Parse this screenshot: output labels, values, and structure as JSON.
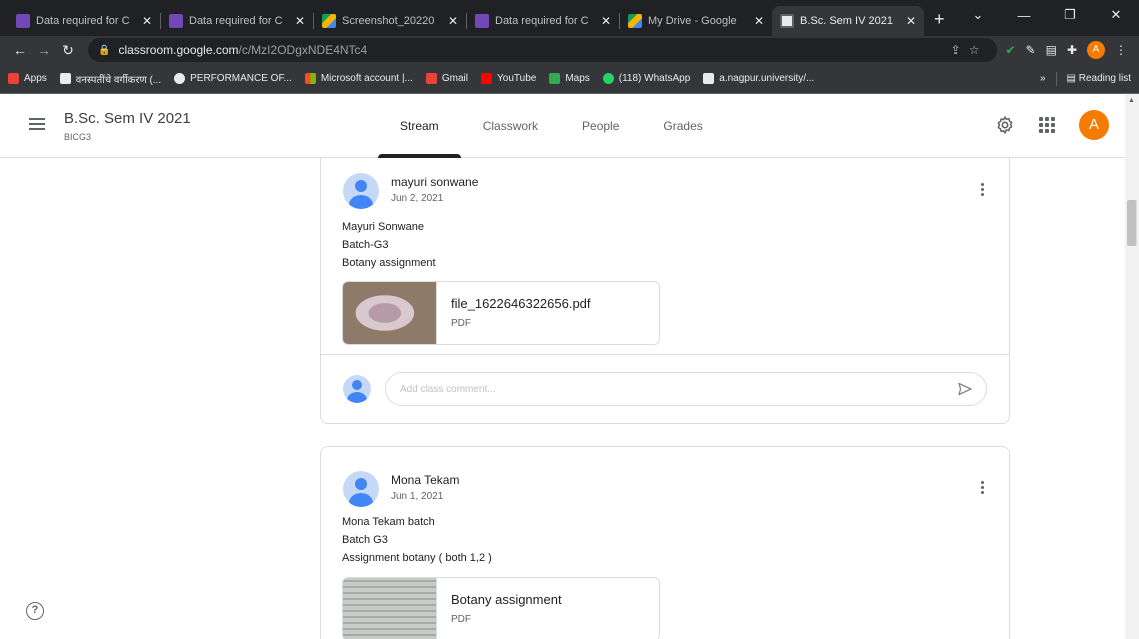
{
  "browser": {
    "tabs": [
      {
        "title": "Data required for C",
        "icon": "forms-icon"
      },
      {
        "title": "Data required for C",
        "icon": "forms-icon"
      },
      {
        "title": "Screenshot_20220",
        "icon": "drive-icon"
      },
      {
        "title": "Data required for C",
        "icon": "forms-icon"
      },
      {
        "title": "My Drive - Google",
        "icon": "drive-icon"
      },
      {
        "title": "B.Sc. Sem IV 2021",
        "icon": "classroom-icon",
        "active": true
      }
    ],
    "url_host": "classroom.google.com",
    "url_path": "/c/MzI2ODgxNDE4NTc4",
    "bookmarks": [
      "Apps",
      "वनस्पतींचे वर्गीकरण (...",
      "PERFORMANCE OF...",
      "Microsoft account |...",
      "Gmail",
      "YouTube",
      "Maps",
      "(118) WhatsApp",
      "a.nagpur.university/..."
    ],
    "reading_list": "Reading list",
    "profile_initial": "A"
  },
  "header": {
    "class_name": "B.Sc. Sem IV 2021",
    "section": "BICG3",
    "tabs": [
      "Stream",
      "Classwork",
      "People",
      "Grades"
    ],
    "active_tab": "Stream",
    "avatar_initial": "A"
  },
  "posts": [
    {
      "author": "mayuri sonwane",
      "date": "Jun 2, 2021",
      "lines": [
        "Mayuri Sonwane",
        "Batch-G3",
        "Botany assignment"
      ],
      "attachment": {
        "title": "file_1622646322656.pdf",
        "type": "PDF"
      },
      "comment_placeholder": "Add class comment..."
    },
    {
      "author": "Mona Tekam",
      "date": "Jun 1, 2021",
      "lines": [
        "Mona Tekam batch",
        "Batch G3",
        "Assignment botany ( both 1,2 )"
      ],
      "attachment": {
        "title": "Botany assignment",
        "type": "PDF"
      }
    }
  ],
  "colors": {
    "accent": "#f57c00",
    "avatar_blue": "#4285f4",
    "border": "#dadce0"
  }
}
